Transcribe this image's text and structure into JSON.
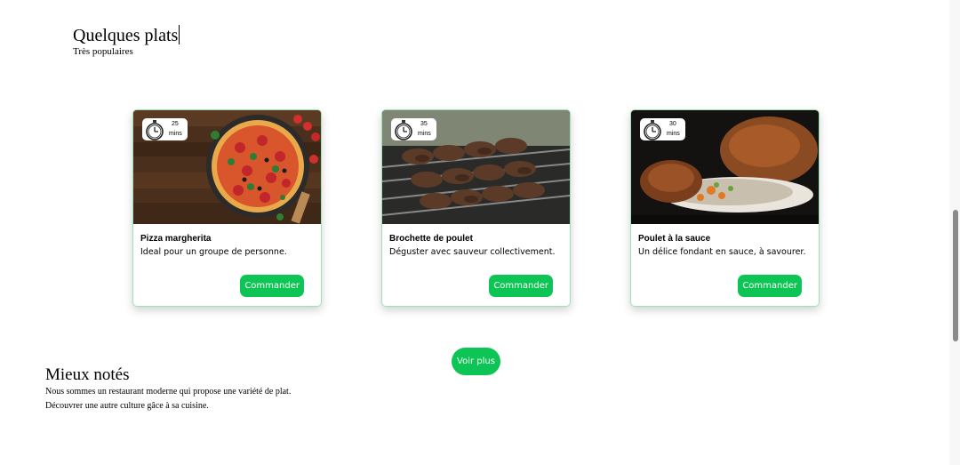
{
  "section": {
    "title": "Quelques plats",
    "subtitle": "Très populaires"
  },
  "dishes": [
    {
      "minutes": "25",
      "unit": "mins",
      "name": "Pizza margherita",
      "desc": "Ideal pour un groupe de personne.",
      "button": "Commander"
    },
    {
      "minutes": "35",
      "unit": "mins",
      "name": "Brochette de poulet",
      "desc": "Déguster avec sauveur collectivement.",
      "button": "Commander"
    },
    {
      "minutes": "30",
      "unit": "mins",
      "name": "Poulet à la sauce",
      "desc": "Un délice fondant en sauce, à savourer.",
      "button": "Commander"
    }
  ],
  "more_button": "Voir plus",
  "best_rated": {
    "title": "Mieux notés",
    "line1": "Nous sommes un restaurant moderne qui propose une variété de plat.",
    "line2": "Découvrer une autre culture gâce à sa cuisine."
  },
  "colors": {
    "accent": "#0cc554",
    "card_border": "#9be3b6"
  },
  "icons": {
    "timer": "stopwatch-icon"
  }
}
